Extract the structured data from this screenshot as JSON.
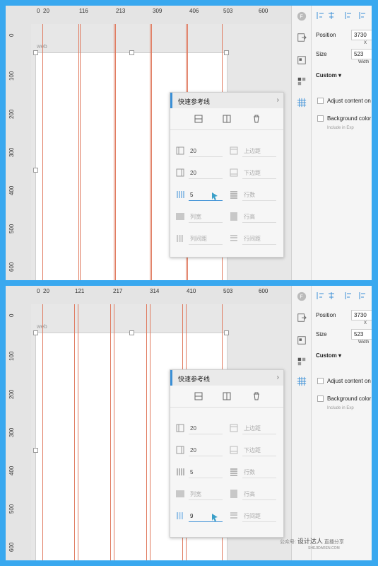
{
  "shots": [
    {
      "hticks": [
        "0",
        "20",
        "116",
        "213",
        "309",
        "406",
        "503",
        "600"
      ],
      "vticks": [
        "0",
        "100",
        "200",
        "300",
        "400",
        "500",
        "600"
      ],
      "artboard_label": "web",
      "popup": {
        "title": "快速参考线",
        "rows": [
          {
            "left": "20",
            "right": "上边距"
          },
          {
            "left": "20",
            "right": "下边距"
          },
          {
            "left": "5",
            "right": "行数"
          },
          {
            "left": "列宽",
            "right": "行高"
          },
          {
            "left": "列间距",
            "right": "行间距"
          }
        ]
      }
    },
    {
      "hticks": [
        "0",
        "20",
        "121",
        "217",
        "314",
        "410",
        "503",
        "600"
      ],
      "vticks": [
        "0",
        "100",
        "200",
        "300",
        "400",
        "500",
        "600"
      ],
      "artboard_label": "web",
      "popup": {
        "title": "快速参考线",
        "rows": [
          {
            "left": "20",
            "right": "上边距"
          },
          {
            "left": "20",
            "right": "下边距"
          },
          {
            "left": "5",
            "right": "行数"
          },
          {
            "left": "列宽",
            "right": "行高"
          },
          {
            "left": "9",
            "right": "行间距"
          }
        ]
      }
    }
  ],
  "props": {
    "position_label": "Position",
    "position_value": "3730",
    "x_label": "X",
    "size_label": "Size",
    "size_value": "523",
    "width_label": "Width",
    "custom_label": "Custom ▾",
    "adjust_label": "Adjust content on",
    "background_label": "Background color",
    "include_label": "Include in Exp"
  },
  "watermark": {
    "text": "公众号:",
    "brand": "设计达人",
    "tag": "直播分享",
    "url": "SHEJIDAREN.COM"
  },
  "colors": {
    "guide": "#e07a5f",
    "accent": "#3a8fd6",
    "frame": "#39a8ef"
  },
  "icons": [
    "logo-icon",
    "align-icons",
    "export-icon",
    "layers-icon",
    "component-icon",
    "grid-icon",
    "trash-icon",
    "cursor-icon"
  ]
}
